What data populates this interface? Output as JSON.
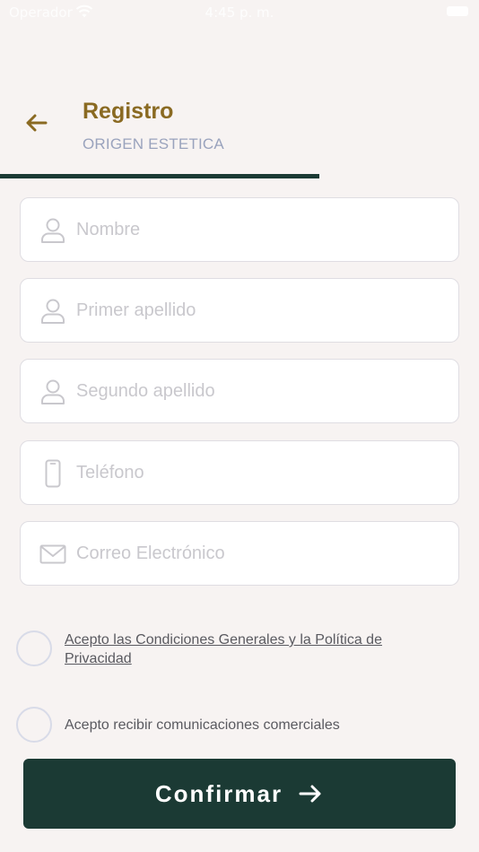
{
  "status_bar": {
    "carrier": "Operador",
    "time": "4:45 p. m."
  },
  "header": {
    "title": "Registro",
    "subtitle": "ORIGEN ESTETICA",
    "back_icon": "arrow-left-icon",
    "progress_fraction": 0.667
  },
  "form": {
    "fields": [
      {
        "placeholder": "Nombre",
        "value": "",
        "icon": "person-icon"
      },
      {
        "placeholder": "Primer apellido",
        "value": "",
        "icon": "person-icon"
      },
      {
        "placeholder": "Segundo apellido",
        "value": "",
        "icon": "person-icon"
      },
      {
        "placeholder": "Teléfono",
        "value": "",
        "icon": "phone-icon"
      },
      {
        "placeholder": "Correo Electrónico",
        "value": "",
        "icon": "mail-icon"
      }
    ]
  },
  "consents": {
    "terms_label": "Acepto las Condiciones Generales y la Política de Privacidad",
    "terms_checked": false,
    "marketing_label": "Acepto recibir comunicaciones comerciales",
    "marketing_checked": false
  },
  "actions": {
    "confirm_label": "Confirmar",
    "confirm_icon": "arrow-right-icon"
  },
  "colors": {
    "background": "#f7f3f2",
    "accent_gold": "#8a6a22",
    "primary_dark": "#1b3a34",
    "subtitle": "#9aa3bd",
    "placeholder": "#c9c8cd"
  }
}
